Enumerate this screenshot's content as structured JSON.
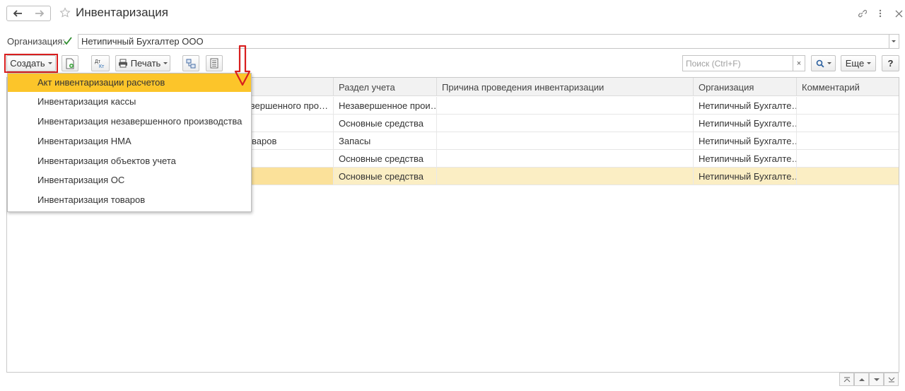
{
  "window": {
    "title": "Инвентаризация",
    "back_icon": "arrow-left-icon",
    "forward_icon": "arrow-right-icon",
    "favorite_icon": "star-icon",
    "link_icon": "link-icon",
    "menu_icon": "more-vertical-icon",
    "close_icon": "close-icon"
  },
  "filter": {
    "label": "Организация:",
    "checked": true,
    "value": "Нетипичный Бухгалтер ООО"
  },
  "toolbar": {
    "create_label": "Создать",
    "print_label": "Печать",
    "more_label": "Еще",
    "help_label": "?",
    "search_placeholder": "Поиск (Ctrl+F)",
    "search_clear": "×",
    "dt_kt_label_top": "Дт",
    "dt_kt_label_bottom": "Кт"
  },
  "create_menu": {
    "items": [
      "Акт инвентаризации расчетов",
      "Инвентаризация кассы",
      "Инвентаризация незавершенного производства",
      "Инвентаризация НМА",
      "Инвентаризация объектов учета",
      "Инвентаризация ОС",
      "Инвентаризация товаров"
    ],
    "active_index": 0
  },
  "table": {
    "columns": [
      "Раздел учета",
      "Причина проведения инвентаризации",
      "Организация",
      "Комментарий"
    ],
    "rows": [
      {
        "hidden_tail": "завершенного про…",
        "section": "Незавершенное прои…",
        "reason": "",
        "org": "Нетипичный Бухгалте…",
        "comment": ""
      },
      {
        "hidden_tail": "",
        "section": "Основные средства",
        "reason": "",
        "org": "Нетипичный Бухгалте…",
        "comment": ""
      },
      {
        "hidden_tail": "варов",
        "section": "Запасы",
        "reason": "",
        "org": "Нетипичный Бухгалте…",
        "comment": ""
      },
      {
        "hidden_tail": "",
        "section": "Основные средства",
        "reason": "",
        "org": "Нетипичный Бухгалте…",
        "comment": ""
      },
      {
        "hidden_tail": "",
        "section": "Основные средства",
        "reason": "",
        "org": "Нетипичный Бухгалте…",
        "comment": ""
      }
    ],
    "selected_row": 4
  },
  "colors": {
    "accent_yellow": "#fcc52a",
    "selected_row": "#fbeec4",
    "highlight_red": "#d81e1e"
  }
}
